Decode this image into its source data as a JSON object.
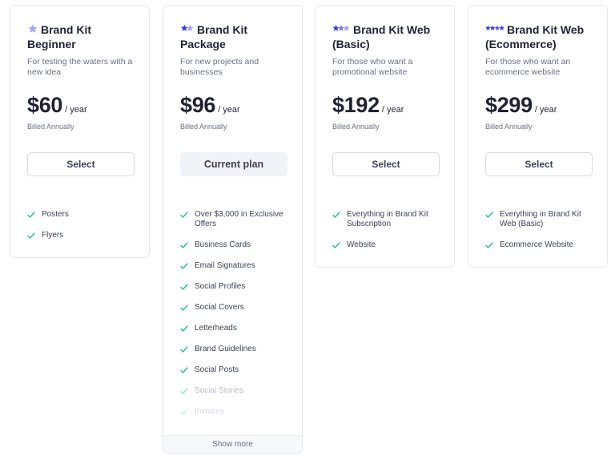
{
  "colors": {
    "star_light": "#a7a9f0",
    "star_dark": "#3b3ee0",
    "check": "#22c08a"
  },
  "plans": [
    {
      "title_line1": "Brand Kit",
      "title_line2": "Beginner",
      "stars": 1,
      "description": "For testing the waters with a new idea",
      "price": "$60",
      "period": "/ year",
      "billing": "Billed Annually",
      "button_label": "Select",
      "features": [
        "Posters",
        "Flyers"
      ]
    },
    {
      "title_line1": "Brand Kit",
      "title_line2": "Package",
      "stars": 2,
      "description": "For new projects and businesses",
      "price": "$96",
      "period": "/ year",
      "billing": "Billed Annually",
      "button_label": "Current plan",
      "features": [
        "Over $3,000 in Exclusive Offers",
        "Business Cards",
        "Email Signatures",
        "Social Profiles",
        "Social Covers",
        "Letterheads",
        "Brand Guidelines",
        "Social Posts",
        "Social Stories",
        "Invoices"
      ],
      "show_more_label": "Show more"
    },
    {
      "title_line1": "Brand Kit Web",
      "title_line2": "(Basic)",
      "stars": 3,
      "description": "For those who want a promotional website",
      "price": "$192",
      "period": "/ year",
      "billing": "Billed Annually",
      "button_label": "Select",
      "features": [
        "Everything in Brand Kit Subscription",
        "Website"
      ]
    },
    {
      "title_line1": "Brand Kit Web",
      "title_line2": "(Ecommerce)",
      "stars": 4,
      "description": "For those who want an ecommerce website",
      "price": "$299",
      "period": "/ year",
      "billing": "Billed Annually",
      "button_label": "Select",
      "features": [
        "Everything in Brand Kit Web (Basic)",
        "Ecommerce Website"
      ]
    }
  ]
}
